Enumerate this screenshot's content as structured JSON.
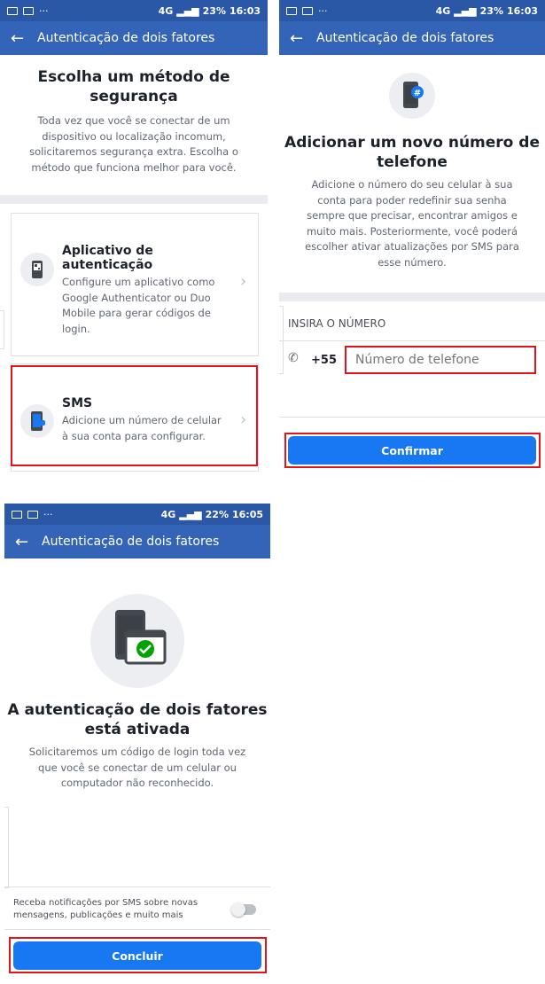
{
  "status1": {
    "icons": "⚡ 🔕 ⏰",
    "network": "4G",
    "battery": "23%",
    "time": "16:03"
  },
  "status2": {
    "icons": "⚡ 🔕 ⏰",
    "network": "4G",
    "battery": "23%",
    "time": "16:03"
  },
  "status3": {
    "icons": "⚡ 🔕 ⏰",
    "network": "4G",
    "battery": "22%",
    "time": "16:05"
  },
  "appbar": {
    "title": "Autenticação de dois fatores",
    "back": "←"
  },
  "screen1": {
    "heading_l1": "Escolha um método de",
    "heading_l2": "segurança",
    "desc": [
      "Toda vez que você se conectar de um",
      "dispositivo ou localização incomum,",
      "solicitaremos segurança extra. Escolha o",
      "método que funciona melhor para você."
    ],
    "option_auth": {
      "title": "Aplicativo de autenticação",
      "desc": [
        "Configure um aplicativo como",
        "Google Authenticator ou Duo",
        "Mobile para gerar códigos de",
        "login."
      ]
    },
    "option_sms": {
      "title": "SMS",
      "desc": [
        "Adicione um número de celular",
        "à sua conta para configurar."
      ]
    }
  },
  "screen2": {
    "heading_l1": "Adicionar um novo número de",
    "heading_l2": "telefone",
    "desc": [
      "Adicione o número do seu celular à sua",
      "conta para poder redefinir sua senha",
      "sempre que precisar, encontrar amigos e",
      "muito mais. Posteriormente, você poderá",
      "escolher ativar atualizações por SMS para",
      "esse número."
    ],
    "section_label": "INSIRA O NÚMERO",
    "country_code": "+55",
    "phone_placeholder": "Número de telefone",
    "confirm": "Confirmar"
  },
  "screen3": {
    "heading_l1": "A autenticação de dois fatores",
    "heading_l2": "está ativada",
    "desc": [
      "Solicitaremos um código de login toda vez",
      "que você se conectar de um celular ou",
      "computador não reconhecido."
    ],
    "sms_notice": [
      "Receba notificações por SMS sobre novas",
      "mensagens, publicações e muito mais"
    ],
    "sms_toggle_on": false,
    "done": "Concluir"
  },
  "colors": {
    "appbar": "#3464b8",
    "statusbar": "#2b57a7",
    "button": "#1877f2",
    "highlight": "#e1141b"
  }
}
